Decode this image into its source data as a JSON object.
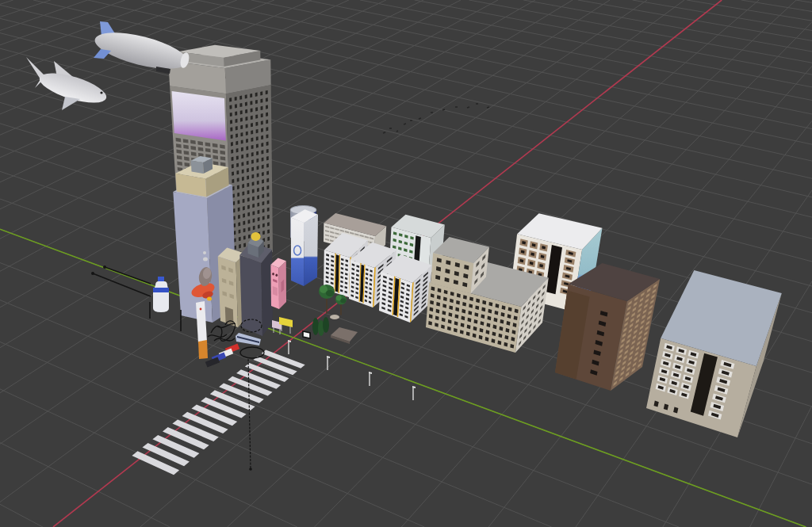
{
  "viewport": {
    "x_axis": {
      "color": "#b1394f"
    },
    "y_axis": {
      "color": "#6d9e20"
    }
  },
  "scene": {
    "objects": [
      {
        "kind": "blimp"
      },
      {
        "kind": "shark"
      },
      {
        "kind": "skyscraper"
      },
      {
        "kind": "flock"
      },
      {
        "kind": "can"
      },
      {
        "kind": "hall"
      },
      {
        "kind": "glass"
      },
      {
        "kind": "carton"
      },
      {
        "kind": "flats"
      },
      {
        "kind": "office"
      },
      {
        "kind": "apartment"
      },
      {
        "kind": "apartment"
      },
      {
        "kind": "apartment"
      },
      {
        "kind": "complex"
      },
      {
        "kind": "cable"
      },
      {
        "kind": "cable"
      },
      {
        "kind": "robot"
      },
      {
        "kind": "spire"
      },
      {
        "kind": "cigarette"
      },
      {
        "kind": "bottle"
      },
      {
        "kind": "pole"
      },
      {
        "kind": "pole"
      },
      {
        "kind": "shop"
      },
      {
        "kind": "brick"
      },
      {
        "kind": "tree"
      },
      {
        "kind": "tree"
      },
      {
        "kind": "billboard"
      },
      {
        "kind": "poster"
      },
      {
        "kind": "shrub"
      },
      {
        "kind": "planter"
      },
      {
        "kind": "halo"
      },
      {
        "kind": "bus"
      },
      {
        "kind": "tangle"
      },
      {
        "kind": "slab"
      },
      {
        "kind": "screen"
      },
      {
        "kind": "ring"
      },
      {
        "kind": "car",
        "color": "#d0302c"
      },
      {
        "kind": "car",
        "color": "#ececec"
      },
      {
        "kind": "car",
        "color": "#3a48b2"
      },
      {
        "kind": "car",
        "color": "#26262b"
      },
      {
        "kind": "lamp"
      },
      {
        "kind": "lamp"
      },
      {
        "kind": "lamp"
      },
      {
        "kind": "lamp"
      },
      {
        "kind": "highrise"
      },
      {
        "kind": "crosswalk"
      },
      {
        "kind": "guide"
      }
    ]
  }
}
